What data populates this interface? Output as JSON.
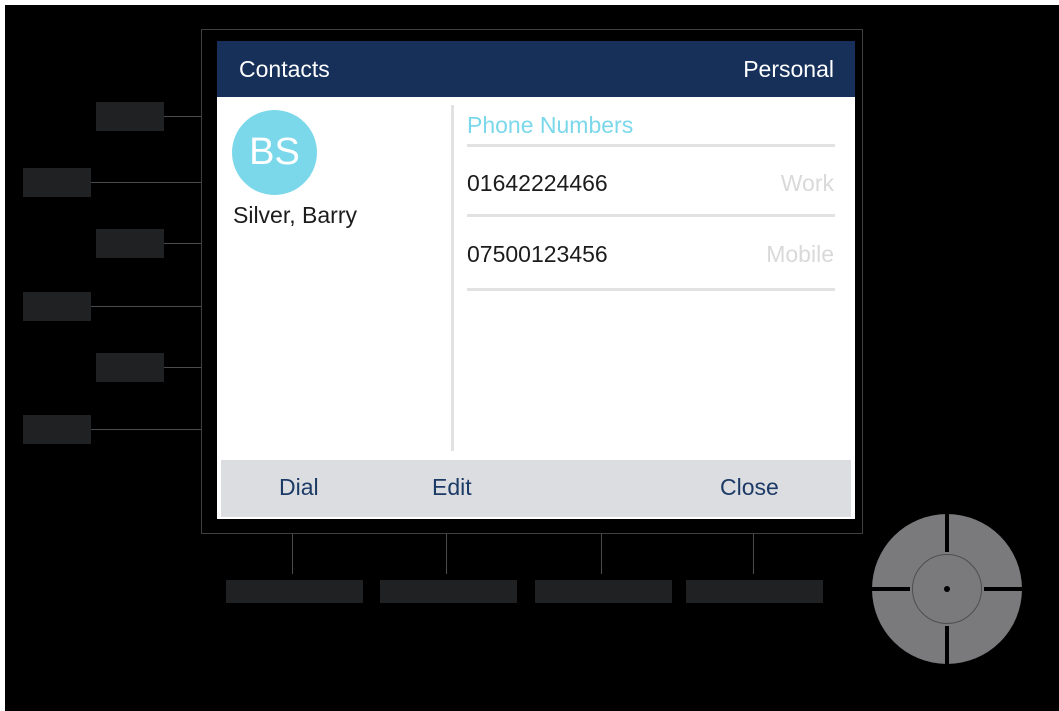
{
  "header": {
    "title": "Contacts",
    "mode": "Personal"
  },
  "contact": {
    "initials": "BS",
    "name": "Silver, Barry",
    "avatar_color": "#7bd8ea"
  },
  "phone_section": {
    "title": "Phone Numbers",
    "numbers": [
      {
        "number": "01642224466",
        "type": "Work"
      },
      {
        "number": "07500123456",
        "type": "Mobile"
      }
    ]
  },
  "softkeys": {
    "dial": "Dial",
    "edit": "Edit",
    "close": "Close"
  },
  "colors": {
    "header_bg": "#16305a",
    "accent": "#7bd8ea",
    "softbar_bg": "#dcdde0",
    "softkey_text": "#1c3a66"
  },
  "icons": {
    "nav_pad": "navigation-pad-icon",
    "nav_ok": "ok-dot-icon"
  }
}
